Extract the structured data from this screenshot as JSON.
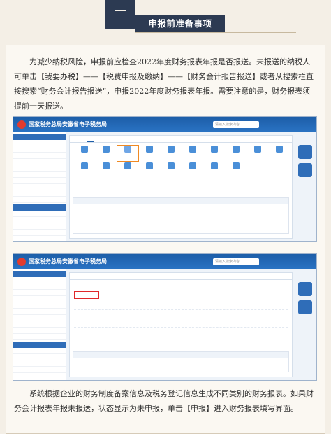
{
  "header": {
    "title": "申报前准备事项"
  },
  "intro_text": "为减少纳税风险，申报前应检查2022年度财务报表年报是否报送。未报送的纳税人可单击【我要办税】——【税费申报及缴纳】——【财务会计报告报送】或者从搜索栏直接搜索“财务会计报告报送”，申报2022年度财务报表年报。需要注意的是，财务报表须提前一天报送。",
  "outro_text": "系统根据企业的财务制度备案信息及税务登记信息生成不同类别的财务报表。如果财务会计报表年报未报送，状态显示为未申报，单击【申报】进入财务报表填写界面。",
  "screenshot1": {
    "site_title": "国家税务总局安徽省电子税务局",
    "search_placeholder": "请输入搜索内容",
    "user_text": "",
    "sidebar_head": "",
    "sidebar_items": [
      "",
      "",
      "",
      "",
      "",
      "",
      "",
      "",
      "",
      ""
    ],
    "sidebar_head2": "",
    "sidebar_items2": [
      "",
      "",
      "",
      "",
      "",
      "",
      "",
      "",
      ""
    ],
    "tabs": [
      "",
      "",
      "",
      "",
      ""
    ],
    "icons": [
      "",
      "",
      "",
      "",
      "",
      "",
      "",
      "",
      "",
      "",
      "",
      "",
      "",
      "",
      "",
      "",
      "",
      ""
    ],
    "table_headers": [
      "",
      "",
      "",
      "",
      ""
    ],
    "table_empty": ""
  },
  "screenshot2": {
    "site_title": "国家税务总局安徽省电子税务局",
    "search_placeholder": "请输入搜索内容",
    "tabs": [
      "",
      "",
      "",
      "",
      "",
      ""
    ],
    "sec1": "",
    "sec2": "",
    "rows": [
      {
        "a": "",
        "b": "",
        "c": "",
        "d": ""
      },
      {
        "a": "",
        "b": "",
        "c": "",
        "d": ""
      },
      {
        "a": "",
        "b": "",
        "c": "",
        "d": ""
      },
      {
        "a": "",
        "b": "",
        "c": "",
        "d": ""
      }
    ]
  },
  "colors": {
    "heading_bg": "#2c3a52",
    "page_bg": "#f4efe6",
    "site_blue": "#1d5ea8",
    "highlight_orange": "#f08a24",
    "highlight_red": "#e0282a"
  }
}
